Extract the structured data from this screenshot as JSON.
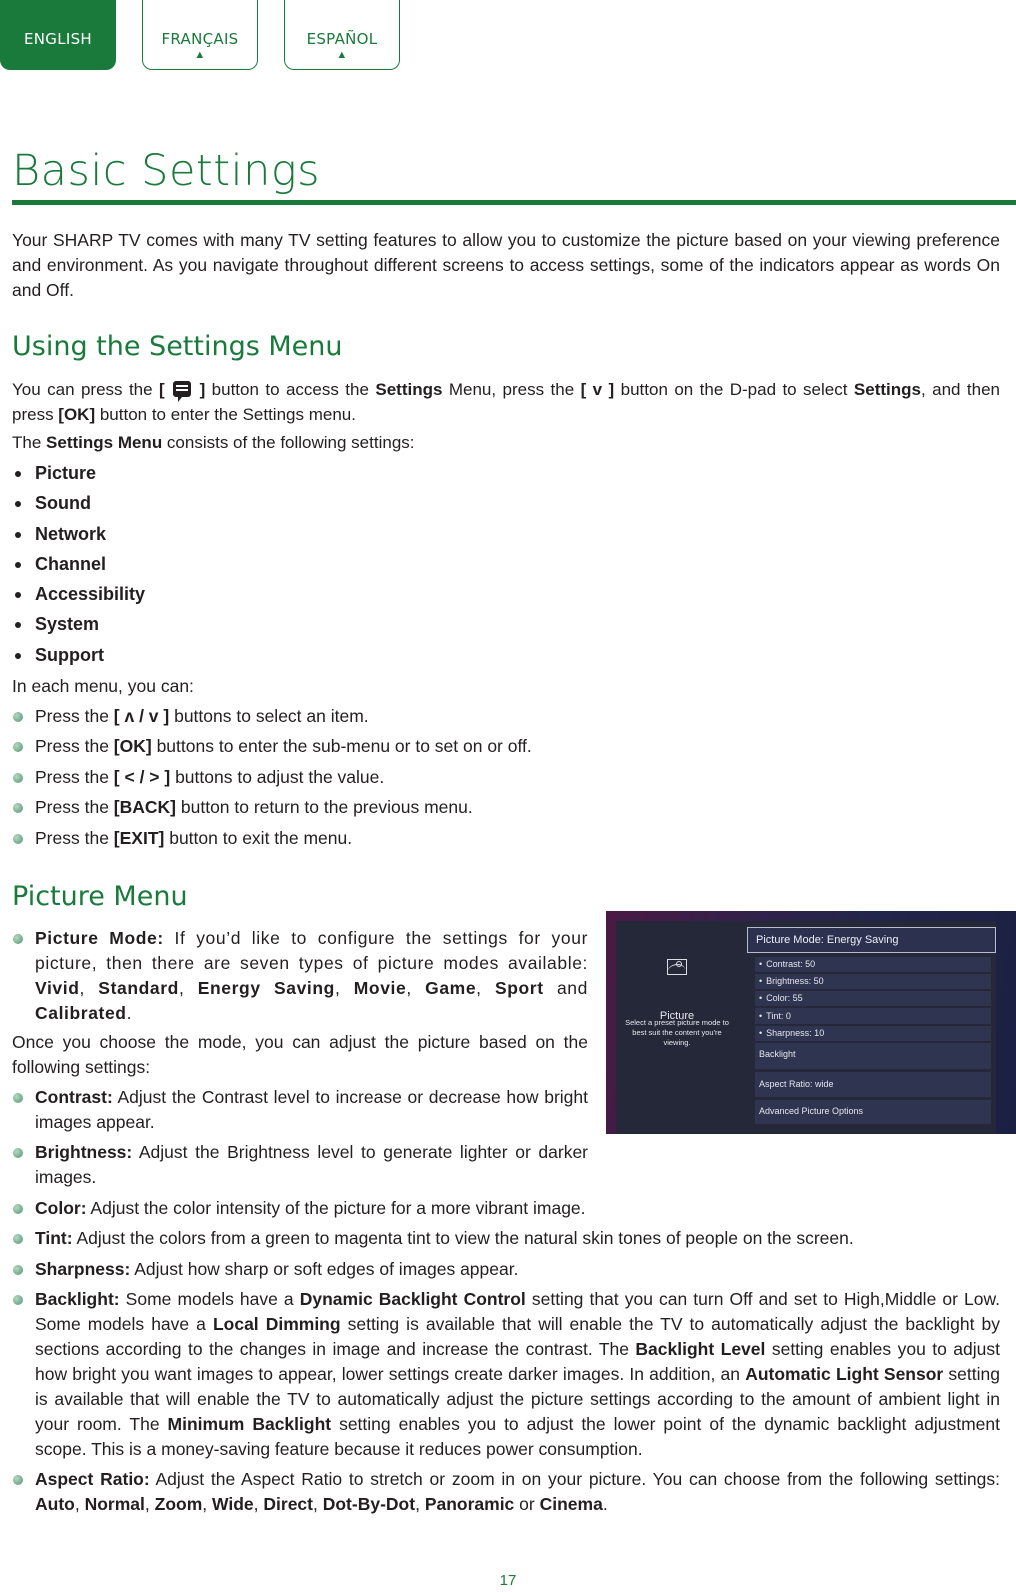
{
  "language_tabs": [
    {
      "label": "ENGLISH",
      "active": true
    },
    {
      "label": "FRANÇAIS",
      "active": false,
      "marker": "▲"
    },
    {
      "label": "ESPAÑOL",
      "active": false,
      "marker": "▲"
    }
  ],
  "page": {
    "title": "Basic Settings",
    "intro": "Your SHARP TV comes with many TV setting features to allow you to customize the picture based on your viewing preference and environment. As you navigate throughout different screens to access settings, some of the indicators appear as words On and Off.",
    "page_number": "17"
  },
  "settings_section": {
    "heading": "Using the Settings Menu",
    "p1": {
      "t1": "You can press the ",
      "b1": "[",
      "icon": "menu-button-icon",
      "b2": "]",
      "t2": " button to access the ",
      "b3": "Settings",
      "t3": " Menu, press the ",
      "b4": "[ v ]",
      "t4": " button on the D-pad to select ",
      "b5": "Settings",
      "t5": ", and then press ",
      "b6": "[OK]",
      "t6": " button to enter the Settings menu."
    },
    "p2": {
      "t1": "The ",
      "b1": "Settings Menu",
      "t2": " consists of the following settings:"
    },
    "menu_items": [
      "Picture",
      "Sound",
      "Network",
      "Channel",
      "Accessibility",
      "System",
      "Support"
    ],
    "p3": "In each menu, you can:",
    "actions": [
      {
        "pre": "Press the ",
        "key": "[ ʌ / v ]",
        "post": " buttons to select an item."
      },
      {
        "pre": "Press the ",
        "key": "[OK]",
        "post": " buttons to enter the sub-menu or to set on or off."
      },
      {
        "pre": "Press the ",
        "key": "[ < / > ]",
        "post": " buttons to adjust the value."
      },
      {
        "pre": "Press the ",
        "key": "[BACK]",
        "post": " button to return to the previous menu."
      },
      {
        "pre": "Press the ",
        "key": "[EXIT]",
        "post": " button to exit the menu."
      }
    ]
  },
  "picture_section": {
    "heading": "Picture Menu",
    "picture_mode": {
      "label": "Picture Mode:",
      "text": " If you’d like to configure the settings for your picture, then there are seven types of picture modes available: ",
      "modes": [
        "Vivid",
        "Standard",
        "Energy Saving",
        "Movie",
        "Game",
        "Sport",
        "Calibrated"
      ],
      "sep": ", ",
      "and": " and ",
      "end": "."
    },
    "once_text": "Once you choose the mode, you can adjust the picture based on the following settings:",
    "items": [
      {
        "label": "Contrast:",
        "text": " Adjust the Contrast level to increase or decrease how bright images appear."
      },
      {
        "label": "Brightness:",
        "text": " Adjust the Brightness level to generate lighter or darker images."
      },
      {
        "label": "Color:",
        "text": " Adjust the color intensity of the picture for a more vibrant image."
      },
      {
        "label": "Tint:",
        "text": " Adjust the colors from a green to magenta tint to view the natural skin tones of people on the screen."
      },
      {
        "label": "Sharpness:",
        "text": " Adjust how sharp or soft edges of images appear."
      }
    ],
    "backlight": {
      "label": "Backlight:",
      "t1": " Some models have a ",
      "b1": "Dynamic Backlight Control",
      "t2": " setting that you can turn Off and set to High,Middle or Low. Some models have a ",
      "b2": "Local Dimming",
      "t3": " setting is available that will enable the TV to automatically adjust the backlight by sections according to the changes in image and increase the contrast. The ",
      "b3": "Backlight Level",
      "t4": " setting enables you to adjust how bright you want images to appear, lower settings create darker images. In addition, an ",
      "b4": "Automatic Light Sensor",
      "t5": " setting is available that will enable the TV to automatically adjust the picture settings according to the amount of ambient light in your room. The ",
      "b5": "Minimum Backlight",
      "t6": " setting enables you to adjust the lower point of the dynamic backlight adjustment scope. This is a money-saving feature because it reduces power consumption."
    },
    "aspect": {
      "label": "Aspect Ratio:",
      "text": " Adjust the Aspect Ratio to stretch or zoom in on your picture. You can choose from the following settings: ",
      "options": [
        "Auto",
        "Normal",
        "Zoom",
        "Wide",
        "Direct",
        "Dot-By-Dot",
        "Panoramic",
        "Cinema"
      ],
      "sep": ", ",
      "or": " or ",
      "end": "."
    }
  },
  "tv_screen": {
    "left_title": "Picture",
    "left_icon": "picture-icon",
    "left_desc": "Select a preset picture mode to best suit the content you're viewing.",
    "selected": "Picture Mode: Energy Saving",
    "sub_items": [
      "Contrast: 50",
      "Brightness: 50",
      "Color: 55",
      "Tint: 0",
      "Sharpness: 10"
    ],
    "rows": [
      "Backlight",
      "Aspect Ratio: wide",
      "Advanced Picture Options"
    ]
  },
  "colors": {
    "brand_green": "#1a7a3c",
    "bullet_green": "#6fa887",
    "tv_panel": "#242838"
  }
}
